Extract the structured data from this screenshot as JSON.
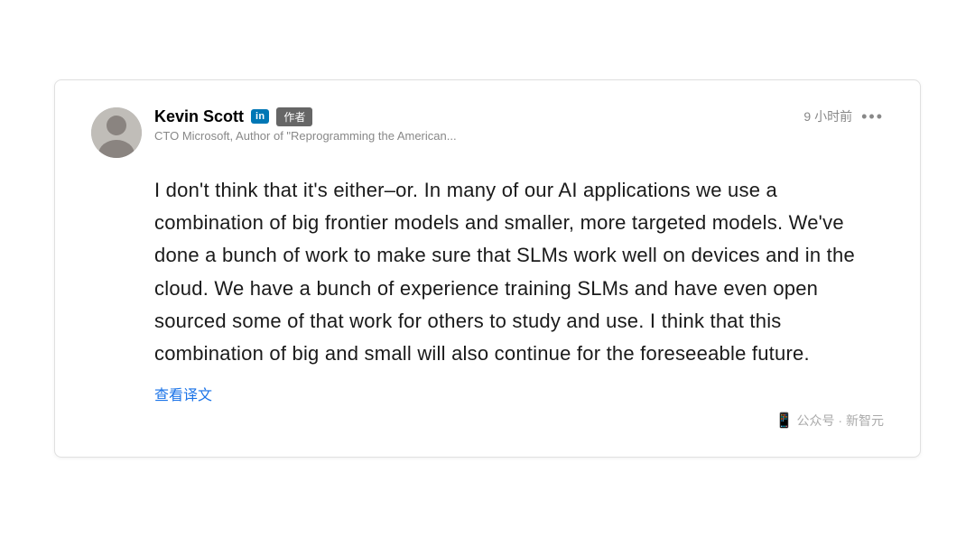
{
  "card": {
    "author": {
      "name": "Kevin Scott",
      "linkedin_label": "in",
      "badge_label": "作者",
      "subtitle": "CTO Microsoft, Author of \"Reprogramming the American..."
    },
    "meta": {
      "time": "9 小时前",
      "more_icon": "•••"
    },
    "content": {
      "text": "I don't think that it's either–or. In many of our AI applications we use a combination of big frontier models and smaller, more targeted models. We've done a bunch of work to make sure that SLMs work well on devices and in the cloud. We have a bunch of experience training SLMs and have even open sourced some of that work for others to study and use. I think that this combination of big and small will also continue for the foreseeable future."
    },
    "translate": {
      "label": "查看译文"
    },
    "footer": {
      "wechat_label": "公众号 · 新智元"
    }
  }
}
